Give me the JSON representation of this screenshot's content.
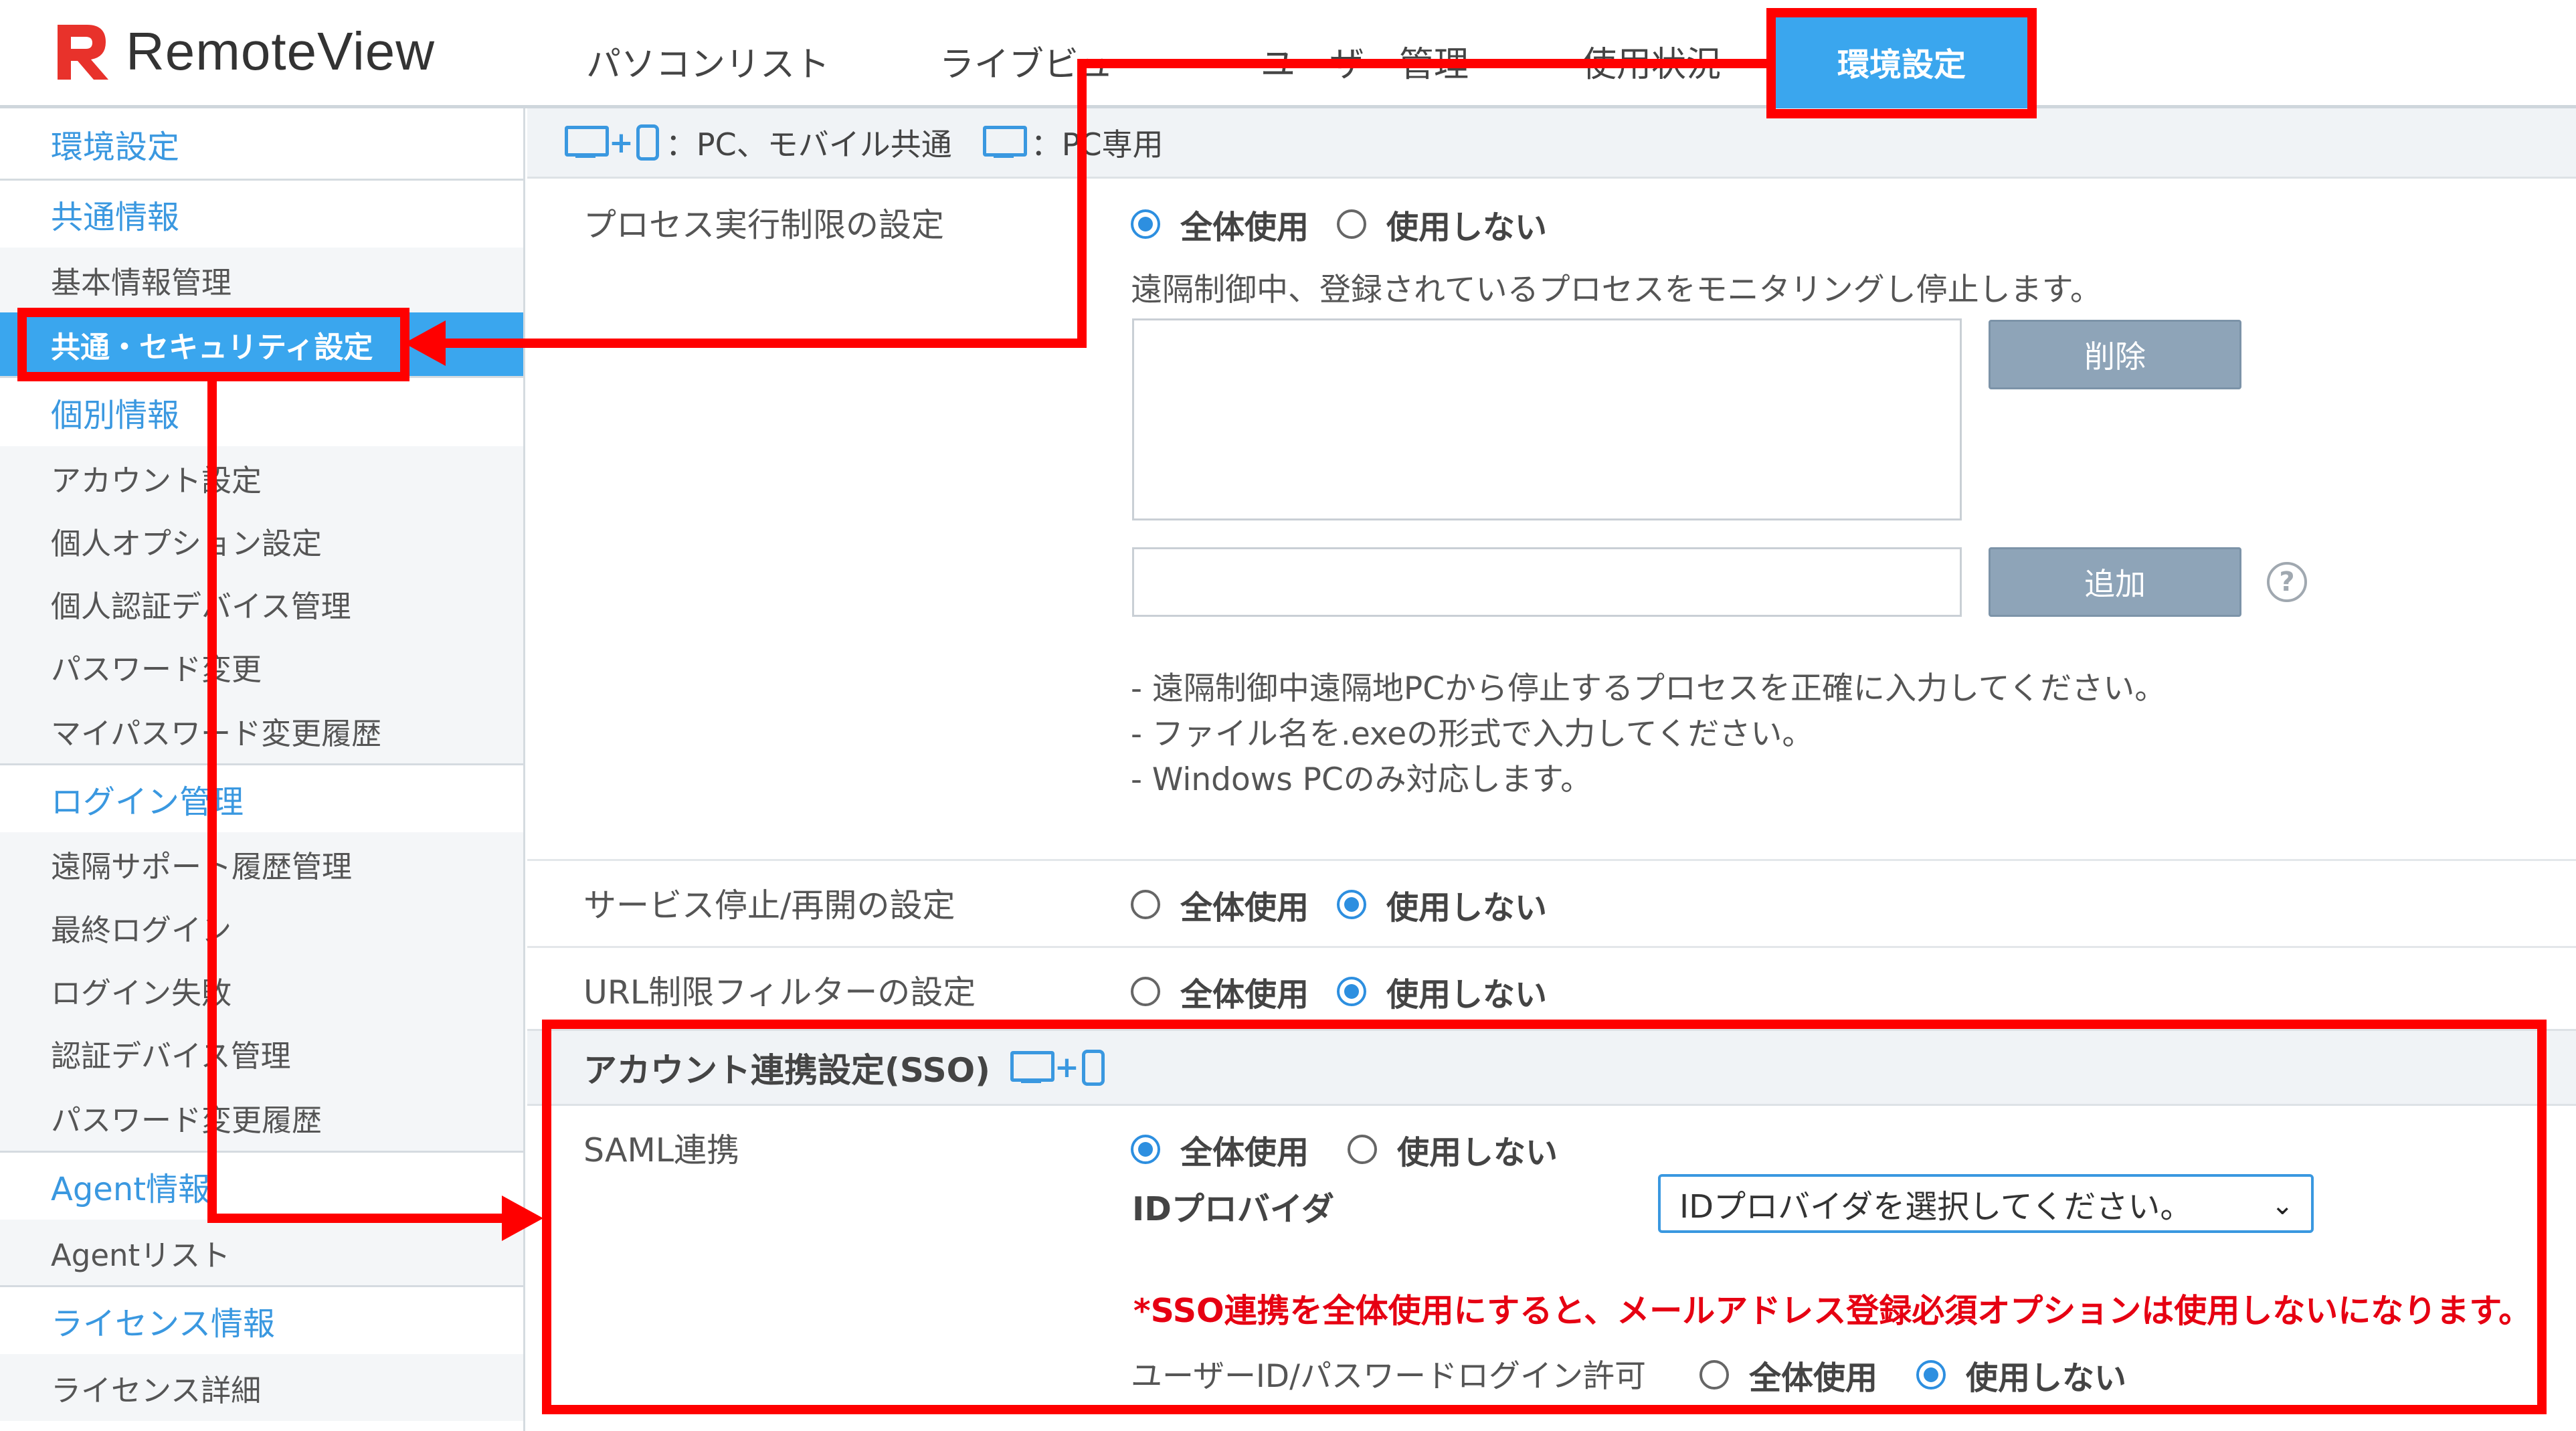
{
  "app": {
    "logo_text": "RemoteView",
    "brand_colors": {
      "accent": "#3aa6ee",
      "link": "#3a98e0",
      "annotation": "#ff0000",
      "warning": "#e60012"
    }
  },
  "nav": {
    "items": [
      {
        "label": "パソコンリスト"
      },
      {
        "label": "ライブビュー"
      },
      {
        "label": "ユーザー管理"
      },
      {
        "label": "使用状況"
      }
    ],
    "active": "環境設定"
  },
  "sidebar": {
    "items": [
      {
        "label": "環境設定",
        "kind": "section"
      },
      {
        "label": "共通情報",
        "kind": "section"
      },
      {
        "label": "基本情報管理",
        "kind": "sub"
      },
      {
        "label": "共通・セキュリティ設定",
        "kind": "active"
      },
      {
        "label": "個別情報",
        "kind": "section"
      },
      {
        "label": "アカウント設定",
        "kind": "sub"
      },
      {
        "label": "個人オプション設定",
        "kind": "sub"
      },
      {
        "label": "個人認証デバイス管理",
        "kind": "sub"
      },
      {
        "label": "パスワード変更",
        "kind": "sub"
      },
      {
        "label": "マイパスワード変更履歴",
        "kind": "sub"
      },
      {
        "label": "ログイン管理",
        "kind": "section"
      },
      {
        "label": "遠隔サポート履歴管理",
        "kind": "sub"
      },
      {
        "label": "最終ログイン",
        "kind": "sub"
      },
      {
        "label": "ログイン失敗",
        "kind": "sub"
      },
      {
        "label": "認証デバイス管理",
        "kind": "sub"
      },
      {
        "label": "パスワード変更履歴",
        "kind": "sub"
      },
      {
        "label": "Agent情報",
        "kind": "section"
      },
      {
        "label": "Agentリスト",
        "kind": "sub"
      },
      {
        "label": "ライセンス情報",
        "kind": "section"
      },
      {
        "label": "ライセンス詳細",
        "kind": "sub"
      }
    ]
  },
  "legend": {
    "common_text": "：PC、モバイル共通",
    "pc_text": "：PC専用"
  },
  "settings": {
    "process": {
      "label": "プロセス実行制限の設定",
      "opt_all": "全体使用",
      "opt_none": "使用しない",
      "selected": "all",
      "description": "遠隔制御中、登録されているプロセスをモニタリングし停止します。",
      "delete_button": "削除",
      "add_button": "追加",
      "input_value": "",
      "notes": [
        "- 遠隔制御中遠隔地PCから停止するプロセスを正確に入力してください。",
        "- ファイル名を.exeの形式で入力してください。",
        "- Windows PCのみ対応します。"
      ]
    },
    "service": {
      "label": "サービス停止/再開の設定",
      "opt_all": "全体使用",
      "opt_none": "使用しない",
      "selected": "none"
    },
    "url": {
      "label": "URL制限フィルターの設定",
      "opt_all": "全体使用",
      "opt_none": "使用しない",
      "selected": "none"
    }
  },
  "sso": {
    "header": "アカウント連携設定(SSO)",
    "saml_label": "SAML連携",
    "opt_all": "全体使用",
    "opt_none": "使用しない",
    "selected": "all",
    "idp_label": "IDプロバイダ",
    "idp_select_value": "IDプロバイダを選択してください。",
    "warning": "*SSO連携を全体使用にすると、メールアドレス登録必須オプションは使用しないになります。",
    "login_label": "ユーザーID/パスワードログイン許可",
    "login_opt_all": "全体使用",
    "login_opt_none": "使用しない",
    "login_selected": "none"
  }
}
